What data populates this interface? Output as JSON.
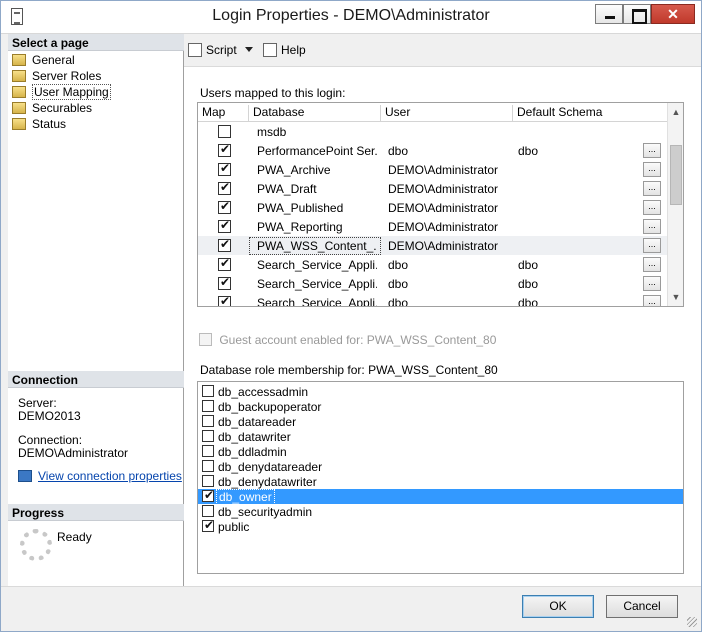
{
  "window": {
    "title": "Login Properties - DEMO\\Administrator"
  },
  "left": {
    "select_page_header": "Select a page",
    "pages": [
      "General",
      "Server Roles",
      "User Mapping",
      "Securables",
      "Status"
    ],
    "connection_header": "Connection",
    "server_label": "Server:",
    "server_value": "DEMO2013",
    "connection_label": "Connection:",
    "connection_value": "DEMO\\Administrator",
    "view_link": "View connection properties",
    "progress_header": "Progress",
    "progress_status": "Ready"
  },
  "toolbar": {
    "script_label": "Script",
    "help_label": "Help"
  },
  "mapping": {
    "section_label": "Users mapped to this login:",
    "columns": [
      "Map",
      "Database",
      "User",
      "Default Schema"
    ],
    "rows": [
      {
        "checked": false,
        "database": "msdb",
        "user": "",
        "schema": "",
        "ellipsis": false
      },
      {
        "checked": true,
        "database": "PerformancePoint Ser...",
        "user": "dbo",
        "schema": "dbo",
        "ellipsis": true
      },
      {
        "checked": true,
        "database": "PWA_Archive",
        "user": "DEMO\\Administrator",
        "schema": "",
        "ellipsis": true
      },
      {
        "checked": true,
        "database": "PWA_Draft",
        "user": "DEMO\\Administrator",
        "schema": "",
        "ellipsis": true
      },
      {
        "checked": true,
        "database": "PWA_Published",
        "user": "DEMO\\Administrator",
        "schema": "",
        "ellipsis": true
      },
      {
        "checked": true,
        "database": "PWA_Reporting",
        "user": "DEMO\\Administrator",
        "schema": "",
        "ellipsis": true
      },
      {
        "checked": true,
        "database": "PWA_WSS_Content_...",
        "user": "DEMO\\Administrator",
        "schema": "",
        "ellipsis": true
      },
      {
        "checked": true,
        "database": "Search_Service_Appli...",
        "user": "dbo",
        "schema": "dbo",
        "ellipsis": true
      },
      {
        "checked": true,
        "database": "Search_Service_Appli...",
        "user": "dbo",
        "schema": "dbo",
        "ellipsis": true
      },
      {
        "checked": true,
        "database": "Search_Service_Appli...",
        "user": "dbo",
        "schema": "dbo",
        "ellipsis": true
      }
    ],
    "selected_row": 6
  },
  "guest_label": "Guest account enabled for: PWA_WSS_Content_80",
  "roles_label": "Database role membership for: PWA_WSS_Content_80",
  "roles": [
    {
      "name": "db_accessadmin",
      "checked": false
    },
    {
      "name": "db_backupoperator",
      "checked": false
    },
    {
      "name": "db_datareader",
      "checked": false
    },
    {
      "name": "db_datawriter",
      "checked": false
    },
    {
      "name": "db_ddladmin",
      "checked": false
    },
    {
      "name": "db_denydatareader",
      "checked": false
    },
    {
      "name": "db_denydatawriter",
      "checked": false
    },
    {
      "name": "db_owner",
      "checked": true
    },
    {
      "name": "db_securityadmin",
      "checked": false
    },
    {
      "name": "public",
      "checked": true
    }
  ],
  "selected_role": 7,
  "buttons": {
    "ok": "OK",
    "cancel": "Cancel",
    "ellipsis": "..."
  }
}
